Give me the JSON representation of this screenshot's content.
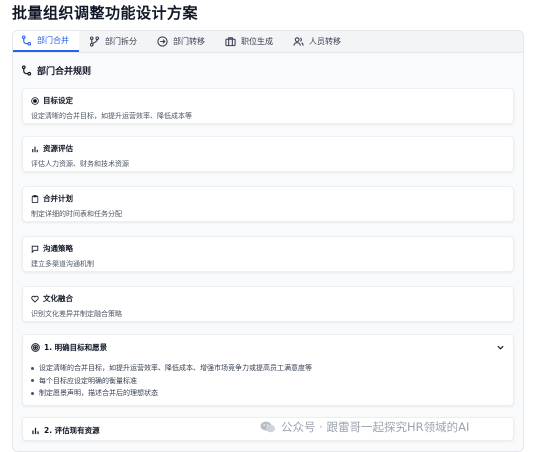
{
  "page": {
    "title": "批量组织调整功能设计方案"
  },
  "tabs": [
    {
      "label": "部门合并",
      "icon": "merge-icon",
      "active": true
    },
    {
      "label": "部门拆分",
      "icon": "split-icon",
      "active": false
    },
    {
      "label": "部门转移",
      "icon": "transfer-icon",
      "active": false
    },
    {
      "label": "职位生成",
      "icon": "briefcase-icon",
      "active": false
    },
    {
      "label": "人员转移",
      "icon": "users-icon",
      "active": false
    }
  ],
  "section": {
    "title": "部门合并规则",
    "icon": "merge-icon"
  },
  "cards": [
    {
      "title": "目标设定",
      "desc": "设定清晰的合并目标，如提升运营效率、降低成本等",
      "icon": "target-icon"
    },
    {
      "title": "资源评估",
      "desc": "评估人力资源、财务和技术资源",
      "icon": "bar-chart-icon"
    },
    {
      "title": "合并计划",
      "desc": "制定详细的时间表和任务分配",
      "icon": "clipboard-icon"
    },
    {
      "title": "沟通策略",
      "desc": "建立多渠道沟通机制",
      "icon": "message-icon"
    },
    {
      "title": "文化融合",
      "desc": "识别文化差异并制定融合策略",
      "icon": "heart-icon"
    }
  ],
  "accordion": [
    {
      "title": "1. 明确目标和愿景",
      "icon": "target-icon",
      "expanded": true,
      "items": [
        "设定清晰的合并目标，如提升运营效率、降低成本、增强市场竞争力或提高员工满意度等",
        "每个目标应设定明确的衡量标准",
        "制定愿景声明，描述合并后的理想状态"
      ]
    },
    {
      "title": "2. 评估现有资源",
      "icon": "bar-chart-icon",
      "expanded": false,
      "items": []
    }
  ],
  "watermark": {
    "text": "公众号 · 跟雷哥一起探究HR领域的AI",
    "icon": "wechat-icon"
  },
  "colors": {
    "accent": "#2563eb",
    "text": "#111827",
    "muted": "#4b5563"
  }
}
